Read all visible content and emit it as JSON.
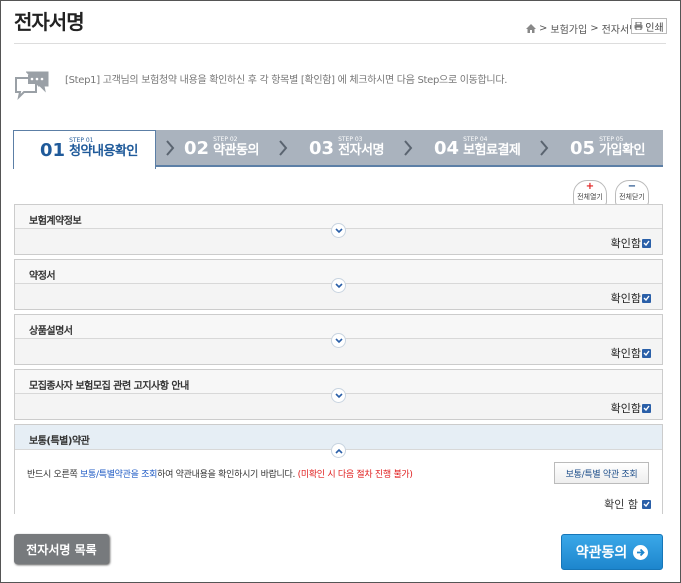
{
  "page": {
    "title": "전자서명",
    "breadcrumb": [
      "보험가입",
      "전자서명"
    ],
    "breadcrumb_sep": ">",
    "print_label": "인쇄"
  },
  "guide": {
    "text": "[Step1] 고객님의 보험청약 내용을 확인하신 후 각 항목별 [확인함] 에 체크하시면 다음 Step으로 이동합니다."
  },
  "steps": [
    {
      "num": "01",
      "small": "STEP 01",
      "label": "청약내용확인",
      "active": true
    },
    {
      "num": "02",
      "small": "STEP 02",
      "label": "약관동의",
      "active": false
    },
    {
      "num": "03",
      "small": "STEP 03",
      "label": "전자서명",
      "active": false
    },
    {
      "num": "04",
      "small": "STEP 04",
      "label": "보험료결제",
      "active": false
    },
    {
      "num": "05",
      "small": "STEP 05",
      "label": "가입확인",
      "active": false
    }
  ],
  "controls": {
    "expand_all": "전체열기",
    "collapse_all": "전체닫기",
    "expand_symbol": "+",
    "collapse_symbol": "−"
  },
  "sections": [
    {
      "title": "보험계약정보",
      "confirm": "확인함"
    },
    {
      "title": "약정서",
      "confirm": "확인함"
    },
    {
      "title": "상품설명서",
      "confirm": "확인함"
    },
    {
      "title": "모집종사자 보험모집 관련 고지사항 안내",
      "confirm": "확인함"
    }
  ],
  "open_section": {
    "title": "보통(특별)약관",
    "notice_prefix": "반드시 오른쪽 ",
    "notice_link": "보통/특별약관을 조회",
    "notice_mid": "하여 약관내용을 확인하시기 바랍니다. ",
    "notice_warning": "(미확인 시 다음 절차 진행 불가)",
    "view_button": "보통/특별 약관 조회",
    "confirm": "확인 함"
  },
  "footer": {
    "list_button": "전자서명 목록",
    "next_button": "약관동의"
  },
  "colors": {
    "step_bar": "#aab3be",
    "active_step": "#1f5a9a",
    "checkbox": "#2a5fa8",
    "next_button": "#2a9be0",
    "warning": "#e02020"
  }
}
